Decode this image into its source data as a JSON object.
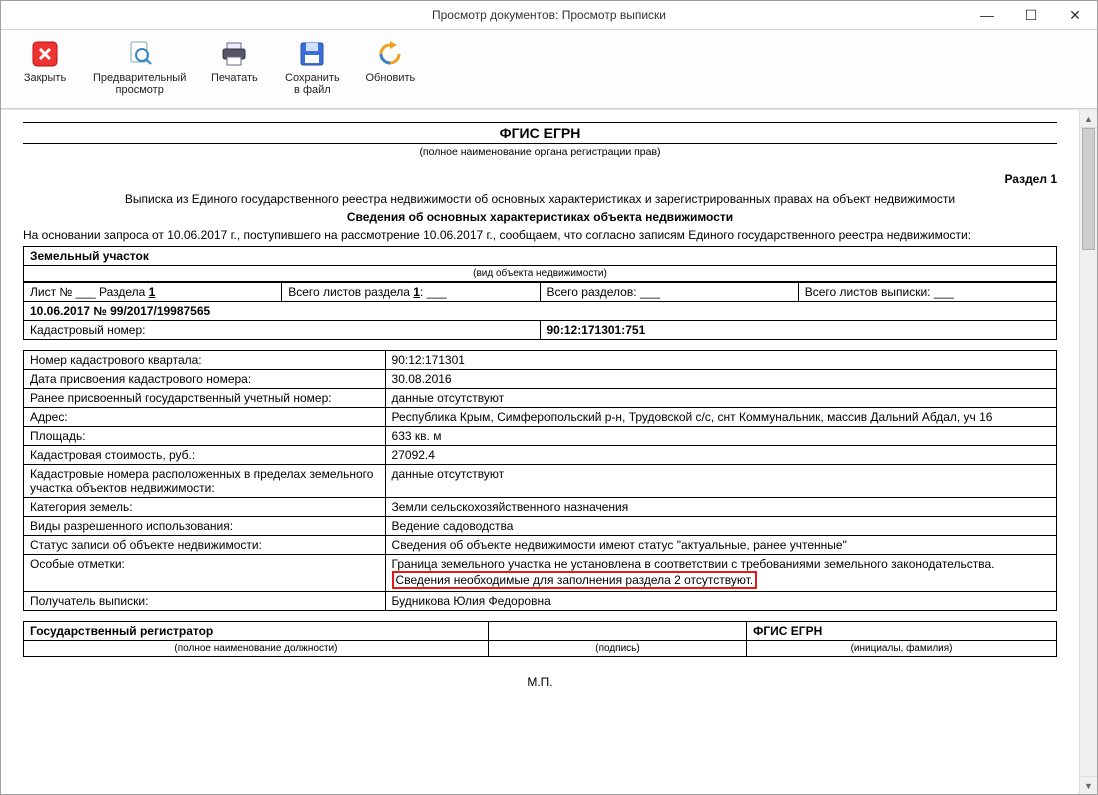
{
  "window": {
    "title": "Просмотр документов: Просмотр выписки"
  },
  "toolbar": {
    "close": "Закрыть",
    "preview": "Предварительный\nпросмотр",
    "print": "Печатать",
    "save": "Сохранить\nв файл",
    "refresh": "Обновить"
  },
  "doc": {
    "system_title": "ФГИС ЕГРН",
    "system_sub": "(полное наименование органа регистрации прав)",
    "section": "Раздел 1",
    "heading_line1": "Выписка из Единого государственного реестра недвижимости об основных характеристиках и зарегистрированных правах на объект недвижимости",
    "heading_line2": "Сведения об основных характеристиках объекта недвижимости",
    "basis": "На основании запроса от 10.06.2017 г., поступившего на рассмотрение 10.06.2017 г., сообщаем, что согласно записям Единого государственного реестра недвижимости:",
    "object_kind": "Земельный участок",
    "object_kind_sub": "(вид объекта недвижимости)",
    "meta": {
      "sheet": "Лист № ___  Раздела ",
      "sheet_num": "1",
      "sheets_in_section": "Всего листов раздела ",
      "sheets_in_section_num": "1",
      "sheets_in_section_tail": ": ___",
      "total_sections": "Всего разделов: ___",
      "total_sheets": "Всего листов выписки: ___"
    },
    "date_num": "10.06.2017    №    99/2017/19987565",
    "cadastral_label": "Кадастровый номер:",
    "cadastral_value": "90:12:171301:751",
    "rows": [
      {
        "label": "Номер кадастрового квартала:",
        "value": "90:12:171301"
      },
      {
        "label": "Дата присвоения кадастрового номера:",
        "value": "30.08.2016"
      },
      {
        "label": "Ранее присвоенный государственный учетный номер:",
        "value": "данные отсутствуют"
      },
      {
        "label": "Адрес:",
        "value": "Республика Крым, Симферопольский р-н, Трудовской с/с, снт Коммунальник, массив Дальний Абдал, уч 16"
      },
      {
        "label": "Площадь:",
        "value": "633 кв. м"
      },
      {
        "label": "Кадастровая стоимость, руб.:",
        "value": "27092.4"
      },
      {
        "label": "Кадастровые номера расположенных в пределах земельного участка объектов недвижимости:",
        "value": "данные отсутствуют"
      },
      {
        "label": "Категория земель:",
        "value": "Земли сельскохозяйственного назначения"
      },
      {
        "label": "Виды разрешенного использования:",
        "value": "Ведение садоводства"
      },
      {
        "label": "Статус записи об объекте недвижимости:",
        "value": "Сведения об объекте недвижимости имеют статус \"актуальные, ранее учтенные\""
      }
    ],
    "notes_label": "Особые отметки:",
    "notes_line1": "Граница земельного участка не установлена в соответствии с требованиями земельного законодательства.",
    "notes_line2": "Сведения необходимые для заполнения раздела 2 отсутствуют.",
    "recipient_label": "Получатель выписки:",
    "recipient_value": "Будникова Юлия Федоровна",
    "sig": {
      "registrar": "Государственный регистратор",
      "registrar_sub": "(полное наименование должности)",
      "sign_sub": "(подпись)",
      "system": "ФГИС ЕГРН",
      "name_sub": "(инициалы, фамилия)"
    },
    "mp": "М.П."
  }
}
